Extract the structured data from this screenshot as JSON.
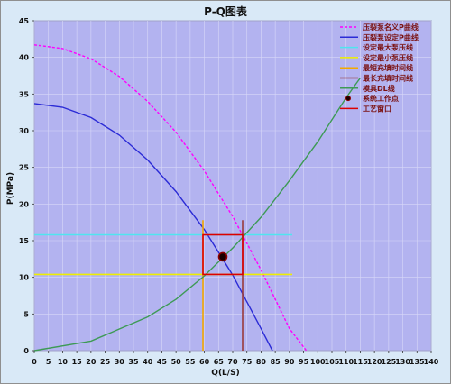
{
  "chart_data": {
    "type": "line",
    "title": "P-Q图表",
    "xlabel": "Q(L/S)",
    "ylabel": "P(MPa)",
    "xlim": [
      0,
      140
    ],
    "ylim": [
      0,
      45
    ],
    "x_ticks": [
      "0",
      "5",
      "10",
      "15",
      "20",
      "25",
      "30",
      "35",
      "40",
      "45",
      "50",
      "55",
      "60",
      "65",
      "70",
      "75",
      "80",
      "85",
      "90",
      "95",
      "100",
      "105",
      "110",
      "115",
      "120",
      "125",
      "130",
      "135",
      "140"
    ],
    "y_ticks": [
      "0",
      "5",
      "10",
      "15",
      "20",
      "25",
      "30",
      "35",
      "40",
      "45"
    ],
    "grid": true,
    "legend_position": "top-right",
    "series": [
      {
        "name": "压裂泵名义P曲线",
        "kind": "line",
        "style": "dashed",
        "color": "#ff00ff",
        "points": [
          [
            0,
            41.7
          ],
          [
            10,
            41.2
          ],
          [
            20,
            39.8
          ],
          [
            30,
            37.4
          ],
          [
            40,
            34.0
          ],
          [
            50,
            29.8
          ],
          [
            60,
            24.5
          ],
          [
            70,
            18.3
          ],
          [
            80,
            11.0
          ],
          [
            90,
            3.0
          ],
          [
            96,
            0
          ]
        ]
      },
      {
        "name": "压裂泵设定P曲线",
        "kind": "line",
        "style": "solid",
        "color": "#2b2bd6",
        "points": [
          [
            0,
            33.7
          ],
          [
            10,
            33.2
          ],
          [
            20,
            31.8
          ],
          [
            30,
            29.4
          ],
          [
            40,
            26.0
          ],
          [
            50,
            21.7
          ],
          [
            60,
            16.5
          ],
          [
            70,
            10.3
          ],
          [
            80,
            3.0
          ],
          [
            84,
            0
          ]
        ]
      },
      {
        "name": "设定最大泵压线",
        "kind": "hline",
        "style": "solid",
        "color": "#4fe5ee",
        "y": 15.8,
        "x_range": [
          0,
          91
        ]
      },
      {
        "name": "设定最小泵压线",
        "kind": "hline",
        "style": "solid",
        "color": "#eeee00",
        "y": 10.4,
        "x_range": [
          0,
          91
        ]
      },
      {
        "name": "最短充填时间线",
        "kind": "vline",
        "style": "solid",
        "color": "#f2a800",
        "x": 59.5,
        "y_range": [
          0,
          17.8
        ]
      },
      {
        "name": "最长充填时间线",
        "kind": "vline",
        "style": "solid",
        "color": "#9a3a3a",
        "x": 73.5,
        "y_range": [
          0,
          17.8
        ]
      },
      {
        "name": "模具DL线",
        "kind": "line",
        "style": "solid",
        "color": "#3d9a55",
        "points": [
          [
            0,
            0
          ],
          [
            20,
            1.3
          ],
          [
            40,
            4.6
          ],
          [
            50,
            7.0
          ],
          [
            60,
            10.2
          ],
          [
            70,
            14.0
          ],
          [
            80,
            18.2
          ],
          [
            90,
            23.2
          ],
          [
            100,
            28.5
          ],
          [
            110,
            34.5
          ],
          [
            115,
            37.2
          ]
        ]
      },
      {
        "name": "系统工作点",
        "kind": "point",
        "color": "#8b0000",
        "x": 66.5,
        "y": 12.8
      },
      {
        "name": "工艺窗口",
        "kind": "rect",
        "color": "#dd0000",
        "x_range": [
          59.5,
          73.5
        ],
        "y_range": [
          10.4,
          15.8
        ]
      }
    ]
  }
}
